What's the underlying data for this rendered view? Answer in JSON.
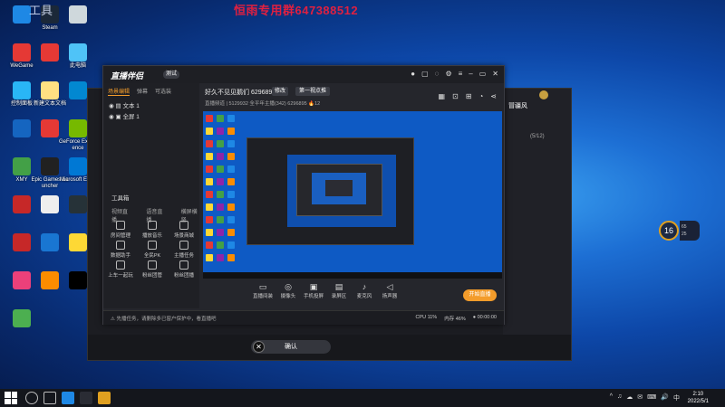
{
  "watermark": {
    "red_text": "恒雨专用群647388512",
    "id_text": "工具"
  },
  "desktop_icons": [
    {
      "label": "",
      "color": "#1e88e5"
    },
    {
      "label": "Steam",
      "color": "#1b2838"
    },
    {
      "label": "",
      "color": "#cfd8dc"
    },
    {
      "label": "WeGame",
      "color": "#e53935"
    },
    {
      "label": "",
      "color": "#e53935"
    },
    {
      "label": "此电脑",
      "color": "#4fc3f7"
    },
    {
      "label": "控制面板",
      "color": "#29b6f6"
    },
    {
      "label": "新建文本文档",
      "color": "#ffe082"
    },
    {
      "label": "",
      "color": "#0288d1"
    },
    {
      "label": "",
      "color": "#1565c0"
    },
    {
      "label": "",
      "color": "#e53935"
    },
    {
      "label": "GeForce Experience",
      "color": "#76b900"
    },
    {
      "label": "XMY",
      "color": "#43a047"
    },
    {
      "label": "Epic Games Launcher",
      "color": "#212121"
    },
    {
      "label": "Microsoft Edge",
      "color": "#0078d4"
    },
    {
      "label": "",
      "color": "#c62828"
    },
    {
      "label": "",
      "color": "#eeeeee"
    },
    {
      "label": "",
      "color": "#263238"
    },
    {
      "label": "",
      "color": "#c62828"
    },
    {
      "label": "",
      "color": "#1976d2"
    },
    {
      "label": "",
      "color": "#fdd835"
    },
    {
      "label": "",
      "color": "#ec407a"
    },
    {
      "label": "",
      "color": "#fb8c00"
    },
    {
      "label": "",
      "color": "#000000"
    },
    {
      "label": "",
      "color": "#4caf50"
    }
  ],
  "bg_window": {
    "confirm_label": "确认",
    "confirm_close": "✕",
    "user_name": "冒疆风",
    "count": "(5/12)"
  },
  "timer": {
    "value": "16",
    "side_a": "65",
    "side_b": "25"
  },
  "main_window": {
    "logo": "直播伴侣",
    "badge": "测试",
    "left_tabs": [
      "场景编辑",
      "弹幕",
      "可选装"
    ],
    "scenes": [
      "文本 1",
      "全屏 1"
    ],
    "tools_title": "工具箱",
    "tools_sub": [
      "视频直播",
      "语音直播",
      "横屏横竖"
    ],
    "tools": [
      {
        "label": "房间管理"
      },
      {
        "label": "播放音乐"
      },
      {
        "label": "场景商城"
      },
      {
        "label": "数据助手"
      },
      {
        "label": "全民PK"
      },
      {
        "label": "主播任务"
      },
      {
        "label": "上车一起玩"
      },
      {
        "label": "粉丝团管"
      },
      {
        "label": "粉丝团播"
      }
    ],
    "stream_title": "好久不见见鹅们 6296895",
    "edit_label": "修改",
    "category": "第一视点推",
    "stream_sub": "直播频道 | 5129932 全平年主播(342) 6296895 🔥12",
    "bottom_tools": [
      {
        "icon": "▭",
        "label": "直播间装"
      },
      {
        "icon": "◎",
        "label": "摄像头"
      },
      {
        "icon": "▣",
        "label": "手机投屏"
      },
      {
        "icon": "▤",
        "label": "录屏区"
      },
      {
        "icon": "♪",
        "label": "麦克风"
      },
      {
        "icon": "◁",
        "label": "扬声器"
      }
    ],
    "live_button": "开始直播",
    "status_msg": "⚠ 先播任务，请删除多已窗户保护中，看直播吧",
    "status_right": [
      "CPU 11%",
      "内存 46%",
      "● 00:00:00"
    ]
  },
  "taskbar": {
    "tray": [
      "^",
      "♫",
      "☁",
      "✉",
      "⌨",
      "🔊",
      "中"
    ],
    "time": "2:10",
    "date": "2022/5/1"
  }
}
